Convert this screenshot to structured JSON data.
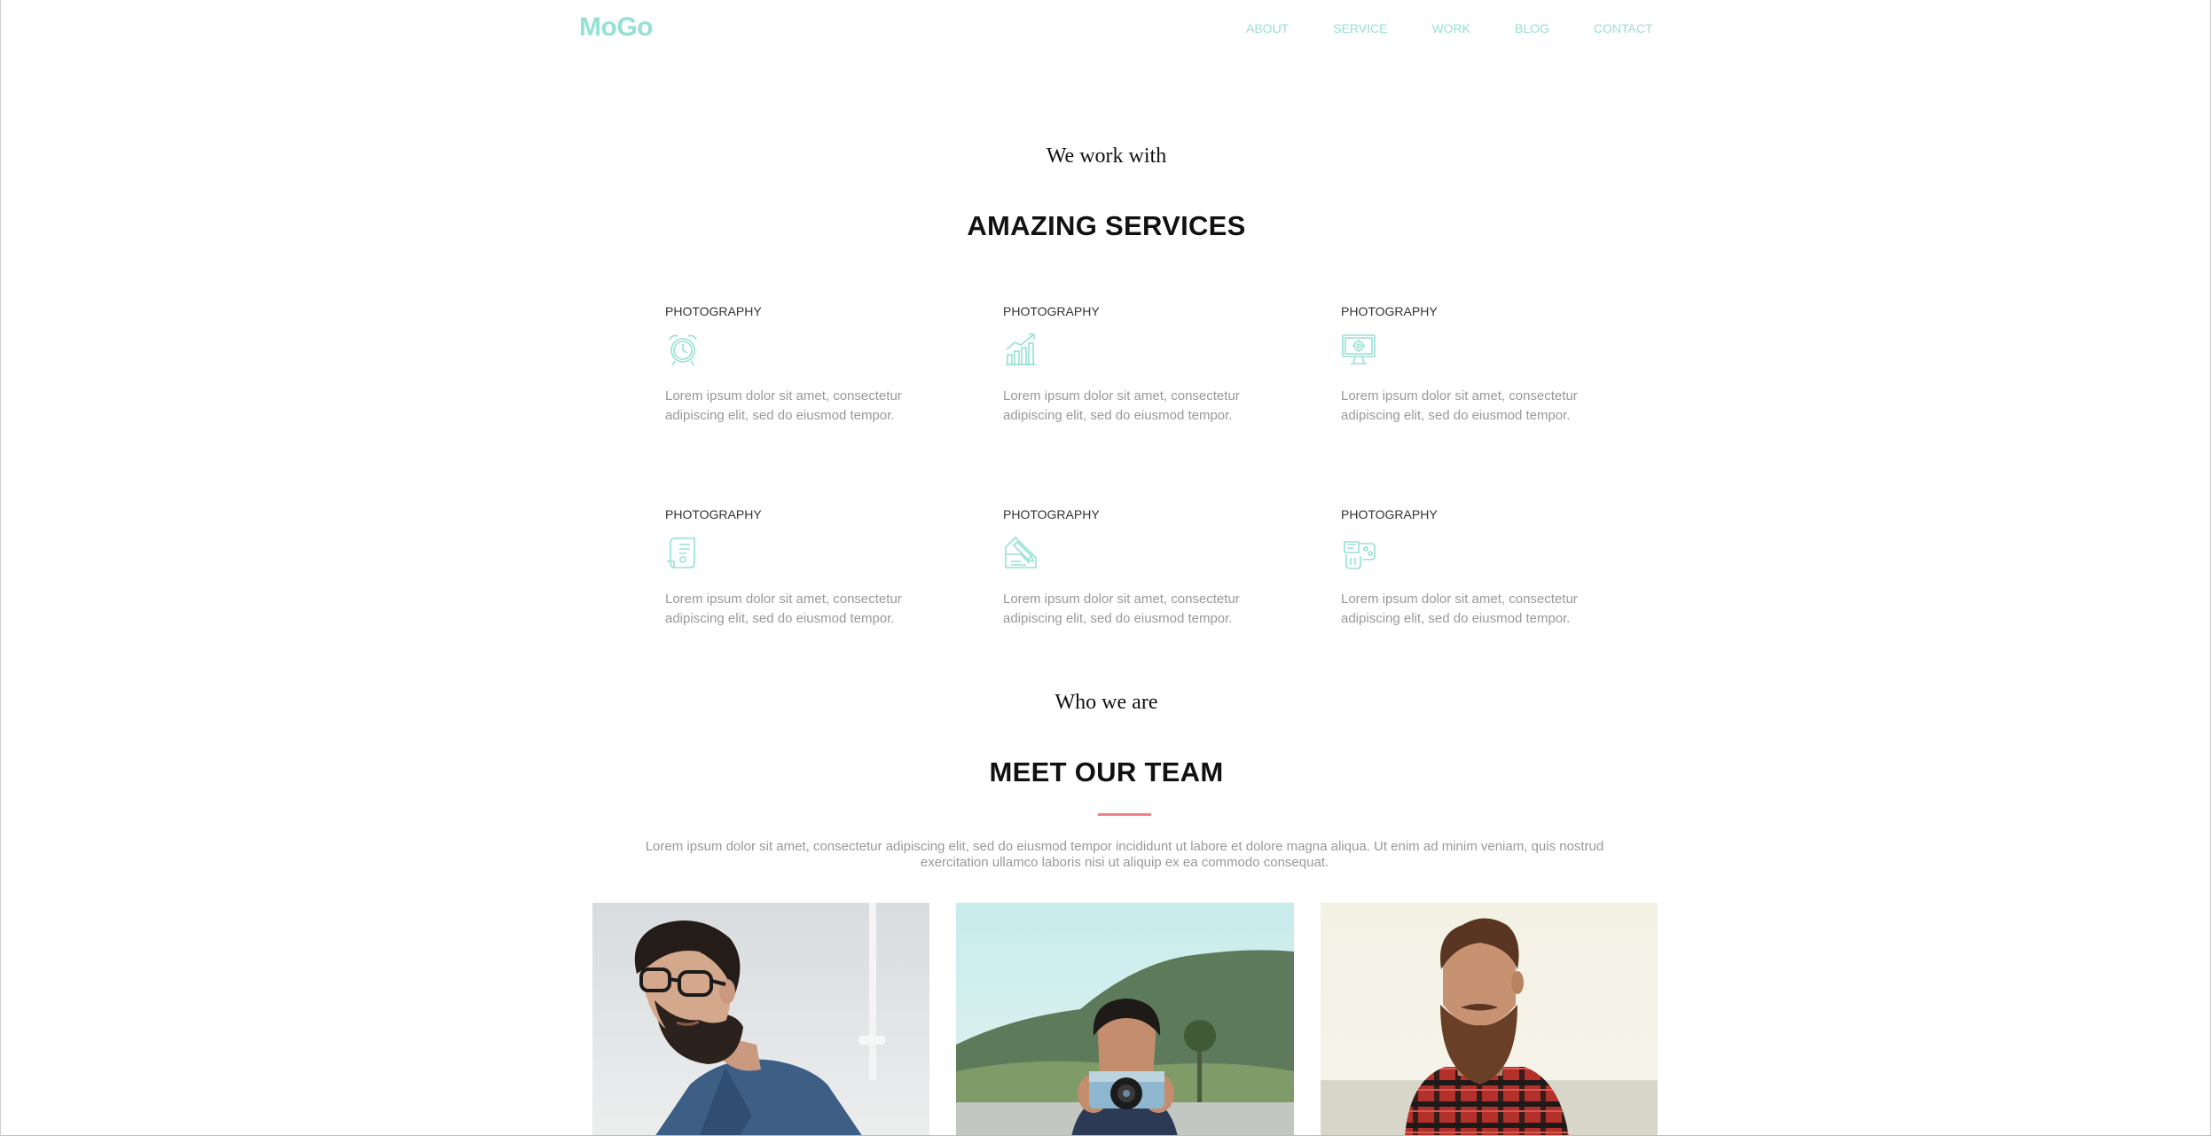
{
  "header": {
    "logo": "MoGo",
    "nav": [
      "ABOUT",
      "SERVICE",
      "WORK",
      "BLOG",
      "CONTACT"
    ]
  },
  "services_section": {
    "subtitle": "We work with",
    "title": "AMAZING SERVICES",
    "items": [
      {
        "title": "PHOTOGRAPHY",
        "icon": "alarm-clock-icon",
        "text": "Lorem ipsum dolor sit amet, consectetur adipiscing elit, sed do eiusmod tempor."
      },
      {
        "title": "PHOTOGRAPHY",
        "icon": "bar-chart-growth-icon",
        "text": "Lorem ipsum dolor sit amet, consectetur adipiscing elit, sed do eiusmod tempor."
      },
      {
        "title": "PHOTOGRAPHY",
        "icon": "monitor-gear-icon",
        "text": "Lorem ipsum dolor sit amet, consectetur adipiscing elit, sed do eiusmod tempor."
      },
      {
        "title": "PHOTOGRAPHY",
        "icon": "document-scroll-icon",
        "text": "Lorem ipsum dolor sit amet, consectetur adipiscing elit, sed do eiusmod tempor."
      },
      {
        "title": "PHOTOGRAPHY",
        "icon": "blueprint-pencil-icon",
        "text": "Lorem ipsum dolor sit amet, consectetur adipiscing elit, sed do eiusmod tempor."
      },
      {
        "title": "PHOTOGRAPHY",
        "icon": "paint-palette-icon",
        "text": "Lorem ipsum dolor sit amet, consectetur adipiscing elit, sed do eiusmod tempor."
      }
    ]
  },
  "team_section": {
    "subtitle": "Who we are",
    "title": "MEET OUR TEAM",
    "text": "Lorem ipsum dolor sit amet, consectetur adipiscing elit, sed do eiusmod tempor incididunt ut labore et dolore magna aliqua. Ut enim ad minim veniam, quis nostrud exercitation ullamco laboris nisi ut aliquip ex ea commodo consequat.",
    "members": [
      {
        "photo": "team-member-glasses-photo"
      },
      {
        "photo": "team-member-camera-photo"
      },
      {
        "photo": "team-member-plaid-shirt-photo"
      }
    ]
  },
  "colors": {
    "accent": "#95e1d3",
    "divider": "#f38181",
    "heading": "#111111",
    "body_text": "#999999"
  }
}
